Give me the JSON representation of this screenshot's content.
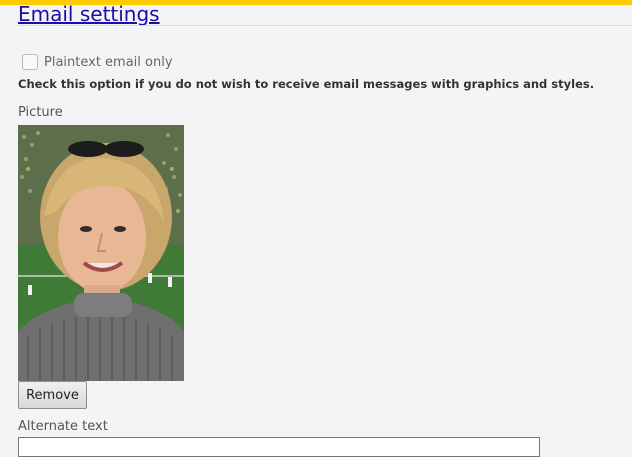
{
  "section": {
    "link_text": "Email settings"
  },
  "plaintext": {
    "label": "Plaintext email only",
    "checked": false,
    "help": "Check this option if you do not wish to receive email messages with graphics and styles."
  },
  "picture": {
    "label": "Picture",
    "remove_label": "Remove"
  },
  "alt_text": {
    "label": "Alternate text",
    "value": ""
  },
  "colors": {
    "accent_bar": "#ffcc00",
    "link": "#1a0dab",
    "background": "#f4f4f6"
  }
}
